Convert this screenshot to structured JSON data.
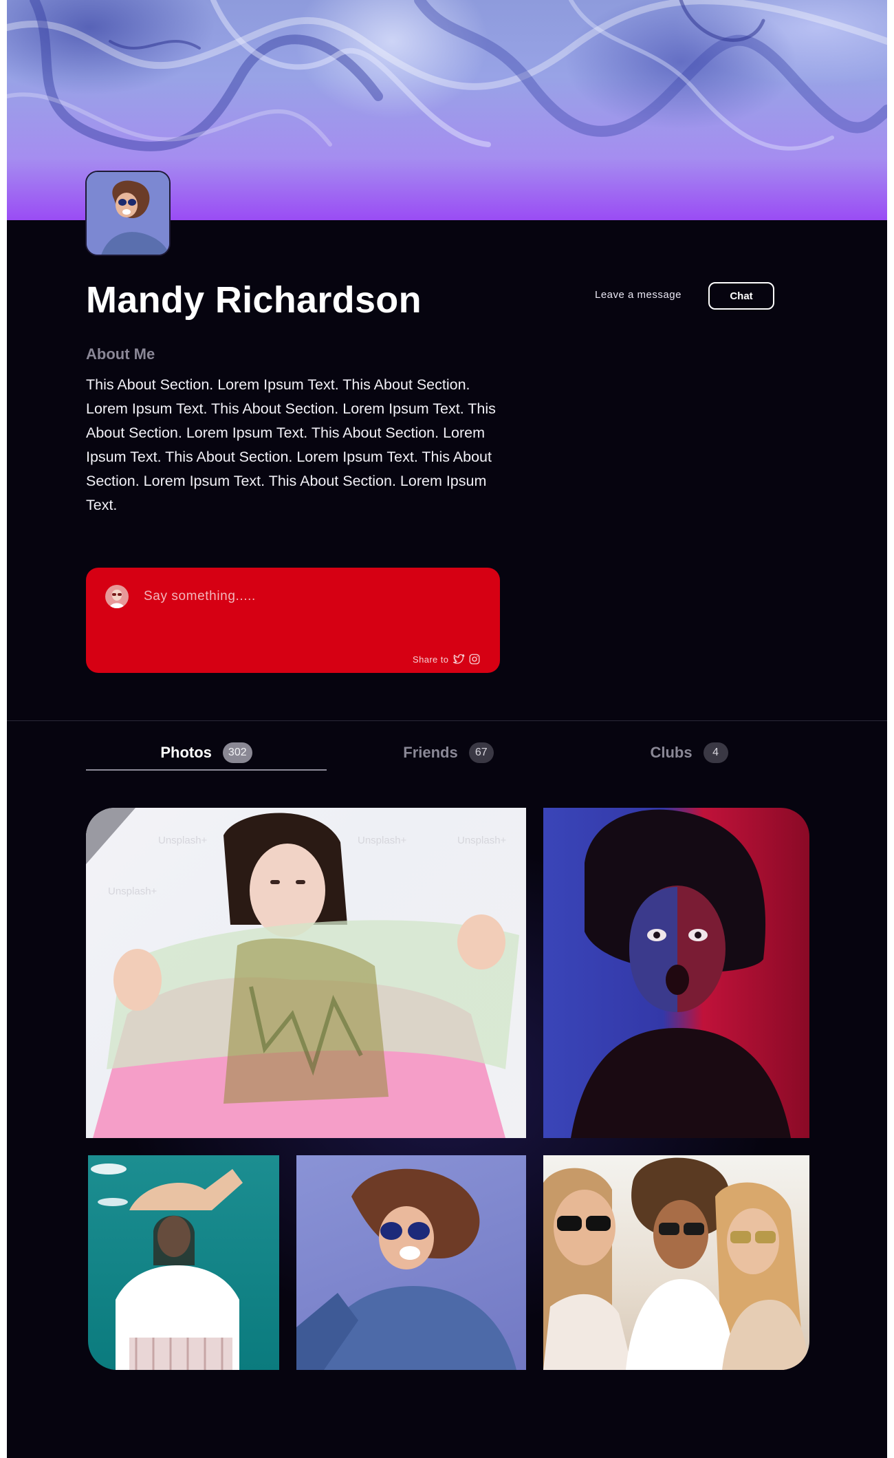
{
  "profile": {
    "name": "Mandy Richardson",
    "leave_message": "Leave a message",
    "chat_label": "Chat",
    "about_title": "About Me",
    "about_text": "This About Section. Lorem Ipsum Text. This About Section. Lorem Ipsum Text. This About Section. Lorem Ipsum Text. This About Section. Lorem Ipsum Text. This About Section. Lorem Ipsum Text. This About Section. Lorem Ipsum Text. This About Section. Lorem Ipsum Text. This About Section. Lorem Ipsum Text."
  },
  "composer": {
    "placeholder": "Say something.....",
    "share_label": "Share to",
    "share_icons": [
      "twitter-icon",
      "instagram-icon"
    ]
  },
  "tabs": [
    {
      "label": "Photos",
      "count": "302",
      "active": true
    },
    {
      "label": "Friends",
      "count": "67",
      "active": false
    },
    {
      "label": "Clubs",
      "count": "4",
      "active": false
    }
  ],
  "photos": {
    "watermark": "Unsplash+",
    "items": [
      "girl-holographic-foil",
      "shocked-woman-red-blue-light",
      "woman-teal-sky",
      "woman-sunglasses-laughing",
      "three-friends-sunglasses"
    ]
  },
  "colors": {
    "background": "#06040f",
    "composer": "#d60013",
    "cover_top": "#8e9bdc",
    "cover_bottom": "#9a4cf4"
  }
}
